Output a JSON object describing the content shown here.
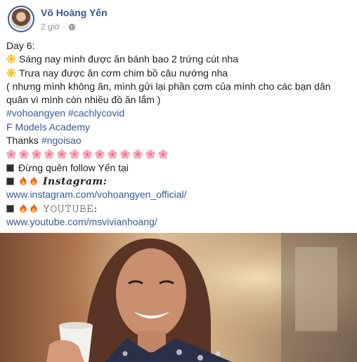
{
  "post": {
    "author": "Võ Hoàng Yến",
    "time": "2 giờ",
    "separator": "·",
    "lines": {
      "day": "Day 6:",
      "breakfast": "Sáng nay mình được ăn bánh bao 2 trứng cút nha",
      "lunch": "Trưa nay được ăn cơm chim bồ câu nướng nha",
      "note": "( nhưng mình không ăn, mình gửi lại phần cơm của mình cho các bạn dân quân vì mình còn nhiều đồ ăn lắm )",
      "hashtags": "#vohoangyen #cachlycovid",
      "page": "F Models Academy",
      "thanks_prefix": "Thanks ",
      "thanks_tag": "#ngoisao",
      "follow": "Đừng quên follow Yến tại",
      "instagram_label": "𝑰𝒏𝒔𝒕𝒂𝒈𝒓𝒂𝒎:",
      "instagram_url": "www.instagram.com/vohoangyen_official/",
      "youtube_label": "𝚈𝙾𝚄𝚃𝚄𝙱𝙴:",
      "youtube_url": "www.youtube.com/msvivianhoang/"
    },
    "icons": {
      "sun": "sun-emoji",
      "flower": "cherry-blossom-emoji",
      "square": "black-square-emoji",
      "fire": "fire-emoji",
      "globe": "globe-icon"
    },
    "colors": {
      "name": "#385898",
      "link": "#365899",
      "meta": "#90949c"
    }
  }
}
